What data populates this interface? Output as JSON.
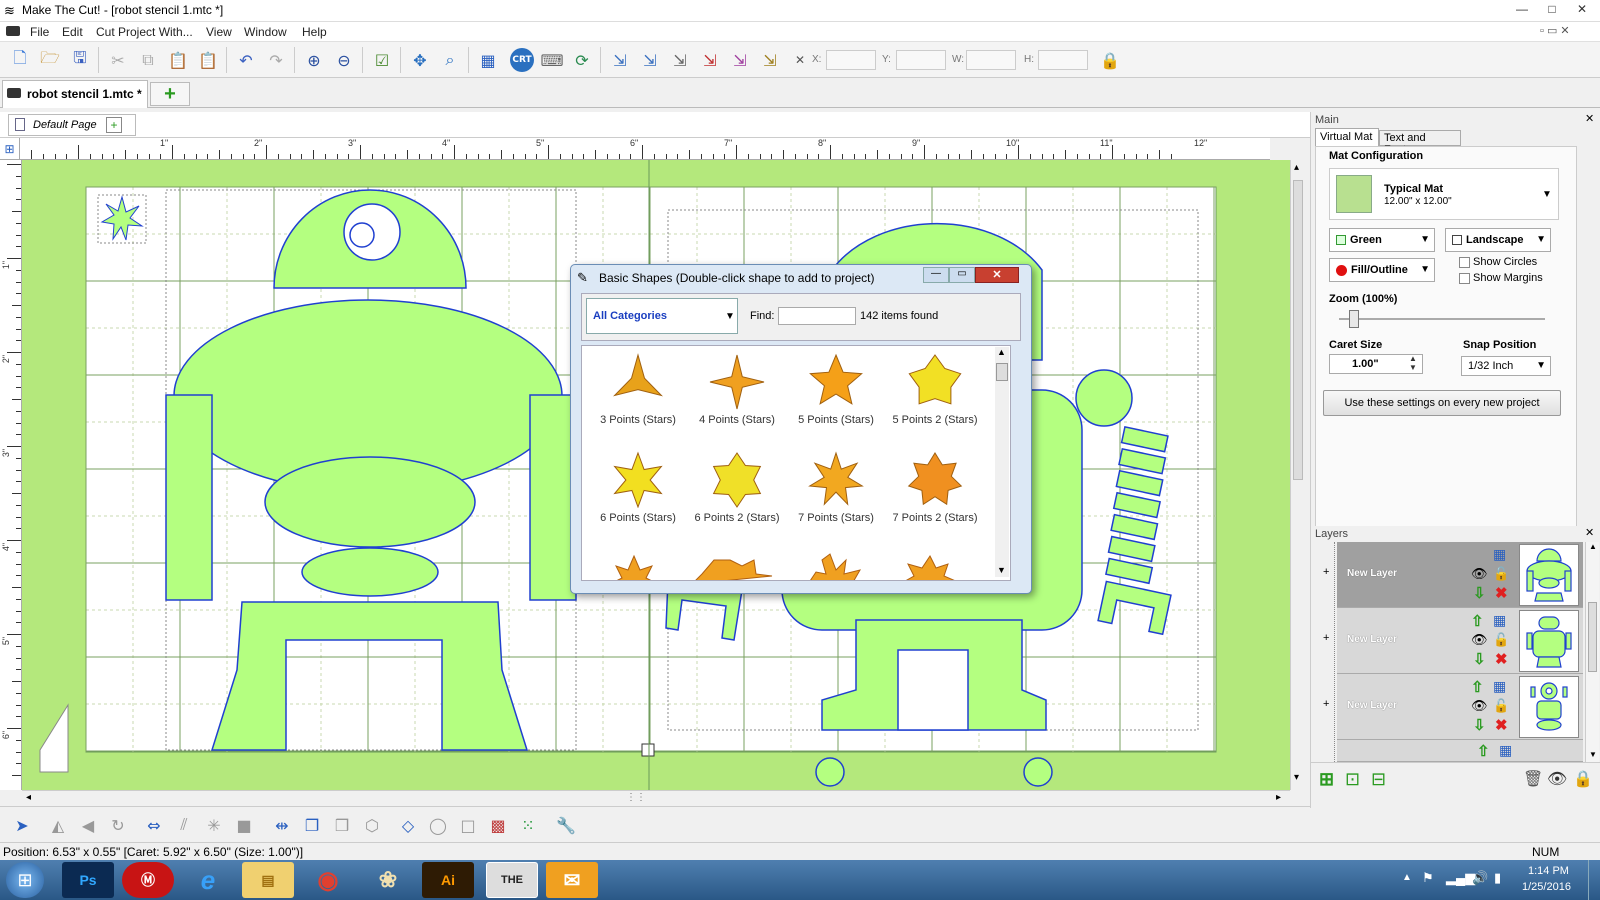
{
  "window": {
    "title": "Make The Cut! - [robot stencil 1.mtc *]",
    "min": "—",
    "max": "□",
    "close": "✕"
  },
  "menu": [
    "File",
    "Edit",
    "Cut Project With...",
    "View",
    "Window",
    "Help"
  ],
  "toolbar": {
    "x_label": "X:",
    "y_label": "Y:",
    "w_label": "W:",
    "h_label": "H:",
    "crt_label": "CRT"
  },
  "document_tab": {
    "label": "robot stencil 1.mtc *"
  },
  "page_tab": {
    "label": "Default Page"
  },
  "ruler_labels": [
    "1\"",
    "2\"",
    "3\"",
    "4\"",
    "5\"",
    "6\"",
    "7\"",
    "8\"",
    "9\"",
    "10\"",
    "11\"",
    "12\""
  ],
  "ruler_v_labels": [
    "1\"",
    "2\"",
    "3\"",
    "4\"",
    "5\"",
    "6\""
  ],
  "dialog": {
    "title": "Basic Shapes (Double-click shape to add to project)",
    "category": "All Categories",
    "find_label": "Find:",
    "find_value": "",
    "count": "142 items found",
    "shapes": [
      {
        "label": "3 Points (Stars)",
        "points": 3,
        "color": "#e8a21a"
      },
      {
        "label": "4 Points (Stars)",
        "points": 4,
        "color": "#f0a020"
      },
      {
        "label": "5 Points (Stars)",
        "points": 5,
        "color": "#f5a018"
      },
      {
        "label": "5 Points 2 (Stars)",
        "points": 5,
        "color": "#f2e024"
      },
      {
        "label": "6 Points (Stars)",
        "points": 6,
        "color": "#f2df20"
      },
      {
        "label": "6 Points 2 (Stars)",
        "points": 6,
        "color": "#f0e028"
      },
      {
        "label": "7 Points (Stars)",
        "points": 7,
        "color": "#f2a820"
      },
      {
        "label": "7 Points 2 (Stars)",
        "points": 7,
        "color": "#f09020"
      }
    ]
  },
  "main_panel": {
    "title": "Main",
    "tabs": [
      "Virtual Mat",
      "Text and Fonts"
    ],
    "mat_config_label": "Mat Configuration",
    "mat_name": "Typical Mat",
    "mat_size": "12.00\" x 12.00\"",
    "color_value": "Green",
    "orientation_value": "Landscape",
    "fill_value": "Fill/Outline",
    "show_circles": "Show Circles",
    "show_margins": "Show Margins",
    "zoom_label": "Zoom (100%)",
    "zoom_level": 0.05,
    "caret_label": "Caret Size",
    "caret_value": "1.00\"",
    "snap_label": "Snap Position",
    "snap_value": "1/32 Inch",
    "apply_button": "Use these settings on every new project"
  },
  "layers_panel": {
    "title": "Layers",
    "layers": [
      {
        "name": "New Layer"
      },
      {
        "name": "New Layer"
      },
      {
        "name": "New Layer"
      }
    ]
  },
  "status": {
    "text": "Position: 6.53\" x 0.55\" [Caret: 5.92\" x 6.50\" (Size: 1.00\")]",
    "num": "NUM"
  },
  "taskbar": {
    "time": "1:14 PM",
    "date": "1/25/2016",
    "apps": [
      "Ps",
      "Ⓜ",
      "e",
      "▤",
      "◉",
      "❀",
      "Ai",
      "THE",
      "✉"
    ]
  },
  "colors": {
    "mat_green": "#b4e87c",
    "shape_green": "#b4ff80",
    "outline_blue": "#2040d0",
    "window_blue": "#dce8f5"
  }
}
